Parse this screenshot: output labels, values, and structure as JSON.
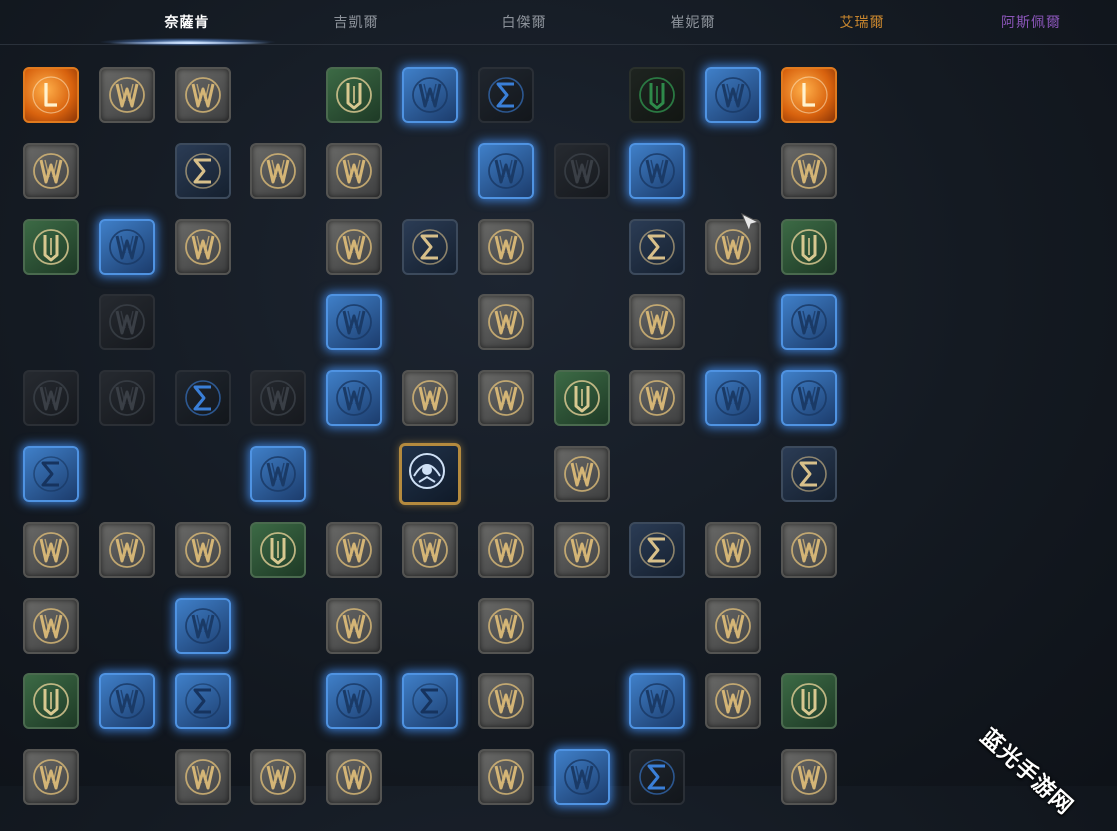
{
  "tabs": [
    {
      "label": "奈薩肯",
      "active": true,
      "color": "#ffffff"
    },
    {
      "label": "吉凱爾",
      "active": false,
      "color": "#8c929a"
    },
    {
      "label": "白傑爾",
      "active": false,
      "color": "#8c929a"
    },
    {
      "label": "崔妮爾",
      "active": false,
      "color": "#8c929a"
    },
    {
      "label": "艾瑞爾",
      "active": false,
      "color": "#c8862e"
    },
    {
      "label": "阿斯佩爾",
      "active": false,
      "color": "#8a55b8"
    }
  ],
  "watermark": "蓝光手游网",
  "legend": {
    "gold": "gold-emblem-icon",
    "green": "green-emblem-icon",
    "blue": "blue-emblem-icon",
    "dark": "dark-emblem-icon",
    "sigma": "sigma-emblem-icon",
    "bluesigma": "blue-sigma-emblem-icon",
    "darkblue": "dark-sigma-emblem-icon",
    "darkgreen": "dark-green-emblem-icon",
    "orange": "orange-emblem-icon",
    "center": "center-emblem-icon"
  },
  "grid": [
    [
      "orange",
      "gold",
      "gold",
      "",
      "green",
      "blue",
      "darkblue",
      "",
      "darkgreen",
      "blue",
      "orange"
    ],
    [
      "gold",
      "",
      "sigma",
      "gold",
      "gold",
      "",
      "blue",
      "dark",
      "blue",
      "",
      "gold"
    ],
    [
      "green",
      "blue",
      "gold",
      "",
      "gold",
      "sigma",
      "gold",
      "",
      "sigma",
      "gold",
      "green"
    ],
    [
      "",
      "dark",
      "",
      "",
      "blue",
      "",
      "gold",
      "",
      "gold",
      "",
      "blue"
    ],
    [
      "dark",
      "dark",
      "darkblue",
      "dark",
      "blue",
      "gold",
      "gold",
      "green",
      "gold",
      "blue",
      "blue"
    ],
    [
      "bluesigma",
      "",
      "",
      "blue",
      "",
      "center",
      "",
      "gold",
      "",
      "",
      "sigma"
    ],
    [
      "gold",
      "gold",
      "gold",
      "green",
      "gold",
      "gold",
      "gold",
      "gold",
      "sigma",
      "gold",
      "gold"
    ],
    [
      "gold",
      "",
      "blue",
      "",
      "gold",
      "",
      "gold",
      "",
      "",
      "gold",
      ""
    ],
    [
      "green",
      "blue",
      "bluesigma",
      "",
      "blue",
      "bluesigma",
      "gold",
      "",
      "blue",
      "gold",
      "green"
    ],
    [
      "gold",
      "",
      "gold",
      "gold",
      "gold",
      "",
      "gold",
      "blue",
      "darkblue",
      "",
      "gold"
    ]
  ]
}
